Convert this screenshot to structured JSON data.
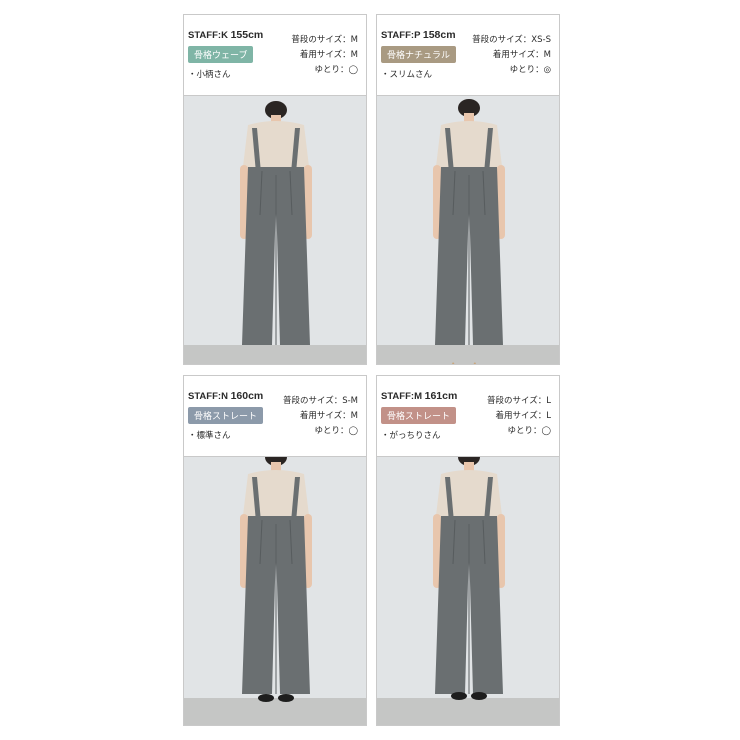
{
  "models": [
    {
      "staff": "STAFF:K",
      "height": "155cm",
      "type": "骨格ウェーブ",
      "type_color": "#7fb5a6",
      "note": "・小柄さん",
      "usual_size": "普段のサイズ：M",
      "worn_size": "着用サイズ：M",
      "fit": "ゆとり：◯",
      "icons": [
        "woman-photo"
      ]
    },
    {
      "staff": "STAFF:P",
      "height": "158cm",
      "type": "骨格ナチュラル",
      "type_color": "#a99a82",
      "note": "・スリムさん",
      "usual_size": "普段のサイズ：XS-S",
      "worn_size": "着用サイズ：M",
      "fit": "ゆとり：◎",
      "icons": [
        "woman-photo"
      ]
    },
    {
      "staff": "STAFF:N",
      "height": "160cm",
      "type": "骨格ストレート",
      "type_color": "#8c9aaa",
      "note": "・標準さん",
      "usual_size": "普段のサイズ：S-M",
      "worn_size": "着用サイズ：M",
      "fit": "ゆとり：◯",
      "icons": [
        "woman-photo"
      ]
    },
    {
      "staff": "STAFF:M",
      "height": "161cm",
      "type": "骨格ストレート",
      "type_color": "#c29188",
      "note": "・がっちりさん",
      "usual_size": "普段のサイズ：L",
      "worn_size": "着用サイズ：L",
      "fit": "ゆとり：◯",
      "icons": [
        "woman-photo"
      ]
    }
  ],
  "colors": {
    "wall": "#e1e4e6",
    "floor": "#c5c6c5",
    "pants": "#6a6f71",
    "top": "#e5dacd",
    "skin": "#e8c6ad",
    "hair": "#2a2523"
  }
}
